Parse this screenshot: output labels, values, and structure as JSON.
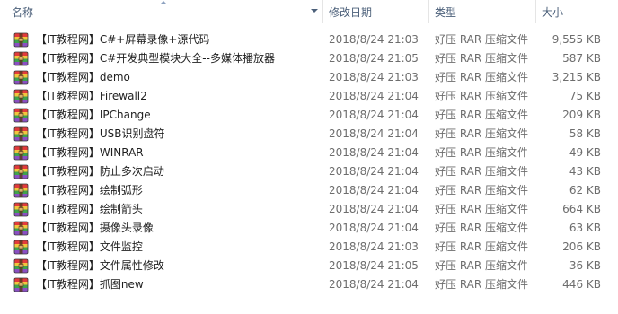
{
  "columns": {
    "name": "名称",
    "date": "修改日期",
    "type": "类型",
    "size": "大小"
  },
  "files": [
    {
      "name": "【IT教程网】C#+屏幕录像+源代码",
      "date": "2018/8/24 21:03",
      "type": "好压 RAR 压缩文件",
      "size": "9,555 KB"
    },
    {
      "name": "【IT教程网】C#开发典型模块大全--多媒体播放器",
      "date": "2018/8/24 21:05",
      "type": "好压 RAR 压缩文件",
      "size": "587 KB"
    },
    {
      "name": "【IT教程网】demo",
      "date": "2018/8/24 21:03",
      "type": "好压 RAR 压缩文件",
      "size": "3,215 KB"
    },
    {
      "name": "【IT教程网】Firewall2",
      "date": "2018/8/24 21:04",
      "type": "好压 RAR 压缩文件",
      "size": "75 KB"
    },
    {
      "name": "【IT教程网】IPChange",
      "date": "2018/8/24 21:04",
      "type": "好压 RAR 压缩文件",
      "size": "209 KB"
    },
    {
      "name": "【IT教程网】USB识别盘符",
      "date": "2018/8/24 21:04",
      "type": "好压 RAR 压缩文件",
      "size": "58 KB"
    },
    {
      "name": "【IT教程网】WINRAR",
      "date": "2018/8/24 21:04",
      "type": "好压 RAR 压缩文件",
      "size": "49 KB"
    },
    {
      "name": "【IT教程网】防止多次启动",
      "date": "2018/8/24 21:04",
      "type": "好压 RAR 压缩文件",
      "size": "43 KB"
    },
    {
      "name": "【IT教程网】绘制弧形",
      "date": "2018/8/24 21:04",
      "type": "好压 RAR 压缩文件",
      "size": "62 KB"
    },
    {
      "name": "【IT教程网】绘制箭头",
      "date": "2018/8/24 21:04",
      "type": "好压 RAR 压缩文件",
      "size": "664 KB"
    },
    {
      "name": "【IT教程网】摄像头录像",
      "date": "2018/8/24 21:04",
      "type": "好压 RAR 压缩文件",
      "size": "63 KB"
    },
    {
      "name": "【IT教程网】文件监控",
      "date": "2018/8/24 21:03",
      "type": "好压 RAR 压缩文件",
      "size": "206 KB"
    },
    {
      "name": "【IT教程网】文件属性修改",
      "date": "2018/8/24 21:05",
      "type": "好压 RAR 压缩文件",
      "size": "36 KB"
    },
    {
      "name": "【IT教程网】抓图new",
      "date": "2018/8/24 21:04",
      "type": "好压 RAR 压缩文件",
      "size": "446 KB"
    }
  ],
  "icon": "rar-archive-icon",
  "colors": {
    "header_text": "#4c607a",
    "name_text": "#1e1e1e",
    "meta_text": "#6d6d6d",
    "separator": "#e5e5e5"
  }
}
